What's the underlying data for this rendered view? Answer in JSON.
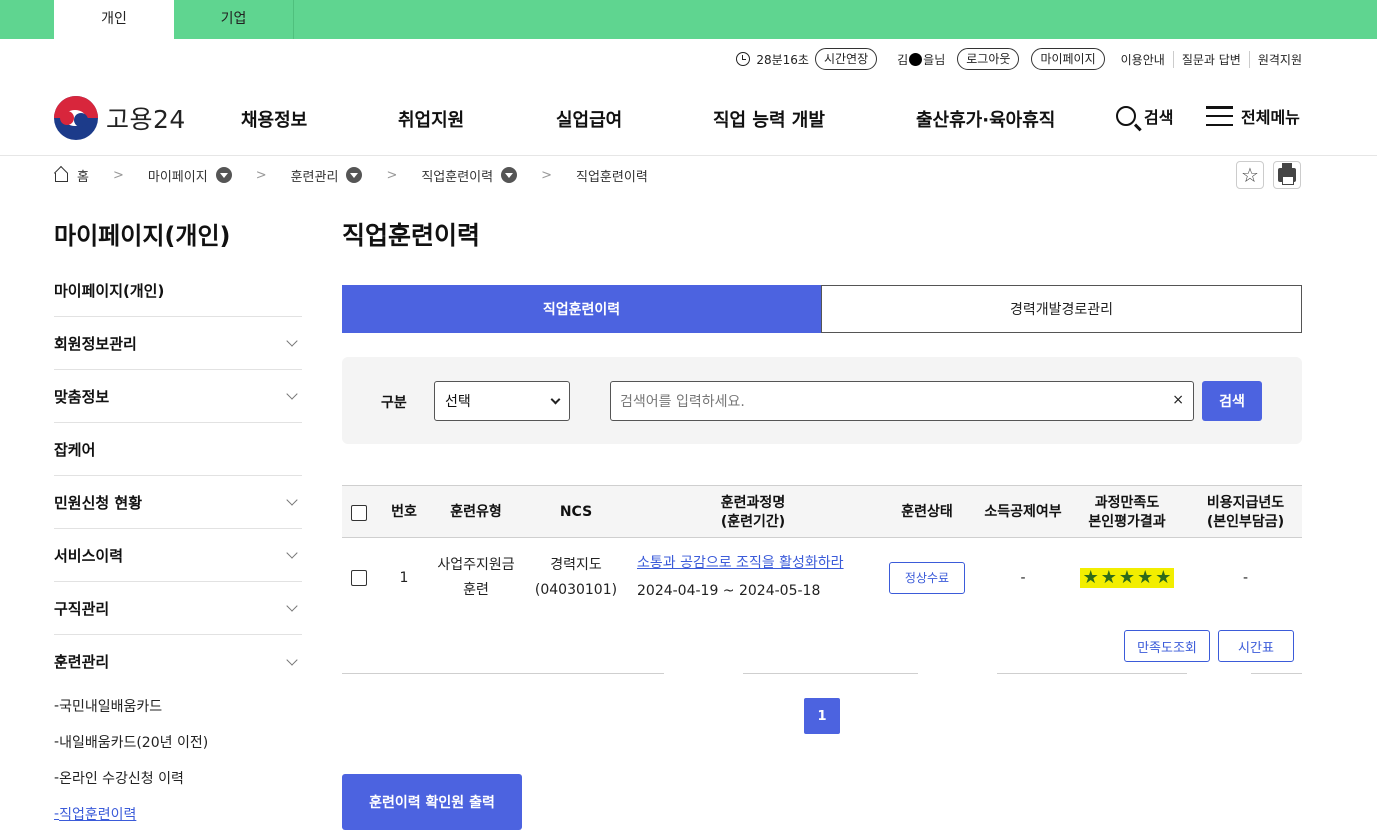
{
  "top_tabs": [
    "개인",
    "기업"
  ],
  "utility": {
    "timer": "28분16초",
    "extend_label": "시간연장",
    "user_prefix": "김",
    "user_suffix": "을님",
    "logout_label": "로그아웃",
    "mypage_label": "마이페이지",
    "links": [
      "이용안내",
      "질문과 답변",
      "원격지원"
    ]
  },
  "logo_text": "고용24",
  "nav": {
    "items": [
      "채용정보",
      "취업지원",
      "실업급여",
      "직업 능력 개발",
      "출산휴가·육아휴직"
    ],
    "search_label": "검색",
    "menu_label": "전체메뉴"
  },
  "breadcrumb": {
    "home": "홈",
    "items": [
      "마이페이지",
      "훈련관리",
      "직업훈련이력",
      "직업훈련이력"
    ]
  },
  "sidebar": {
    "title": "마이페이지(개인)",
    "items": [
      "마이페이지(개인)",
      "회원정보관리",
      "맞춤정보",
      "잡케어",
      "민원신청 현황",
      "서비스이력",
      "구직관리",
      "훈련관리"
    ],
    "sub_items": [
      "국민내일배움카드",
      "내일배움카드(20년 이전)",
      "온라인 수강신청 이력",
      "직업훈련이력"
    ]
  },
  "content": {
    "title": "직업훈련이력",
    "tabs": [
      "직업훈련이력",
      "경력개발경로관리"
    ],
    "search": {
      "label": "구분",
      "select_value": "선택",
      "placeholder": "검색어를 입력하세요.",
      "clear": "×",
      "button": "검색"
    }
  },
  "table": {
    "headers": [
      "번호",
      "훈련유형",
      "NCS",
      "훈련과정명",
      "(훈련기간)",
      "훈련상태",
      "소득공제여부",
      "과정만족도",
      "본인평가결과",
      "비용지급년도",
      "(본인부담금)"
    ],
    "rows": [
      {
        "no": "1",
        "type_line1": "사업주지원금",
        "type_line2": "훈련",
        "ncs_line1": "경력지도",
        "ncs_line2": "(04030101)",
        "course_name": "소통과 공감으로 조직을 활성화하라",
        "period": "2024-04-19 ~ 2024-05-18",
        "status": "정상수료",
        "tax_deduction": "-",
        "rating": 5,
        "rating_max": 5,
        "payment": "-"
      }
    ],
    "action_buttons": [
      "만족도조회",
      "시간표"
    ]
  },
  "pagination": {
    "current": "1"
  },
  "print_button": "훈련이력 확인원 출력",
  "colors": {
    "topbar": "#5fd590",
    "primary": "#4c63e0",
    "link": "#3b5bd9",
    "highlight": "#f2ee00"
  }
}
